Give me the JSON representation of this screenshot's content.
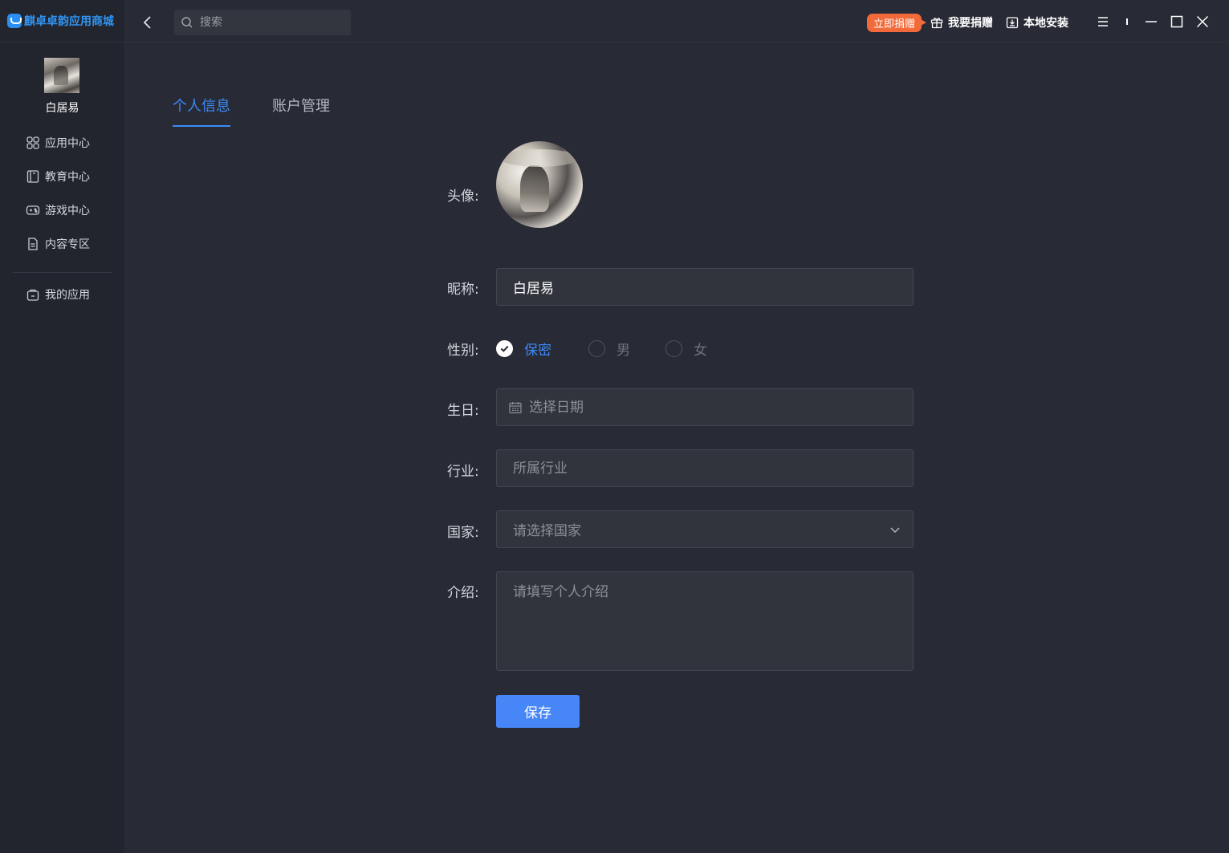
{
  "app": {
    "logo_text": "麒卓卓韵应用商城"
  },
  "sidebar": {
    "user_name": "白居易",
    "items": [
      {
        "label": "应用中心",
        "icon": "apps-grid-icon"
      },
      {
        "label": "教育中心",
        "icon": "book-icon"
      },
      {
        "label": "游戏中心",
        "icon": "gamepad-icon"
      },
      {
        "label": "内容专区",
        "icon": "document-icon"
      }
    ],
    "my_apps": {
      "label": "我的应用",
      "icon": "bag-icon"
    }
  },
  "topbar": {
    "search_placeholder": "搜索",
    "donate_badge": "立即捐赠",
    "donate_label": "我要捐赠",
    "local_install_label": "本地安装"
  },
  "tabs": [
    {
      "label": "个人信息",
      "active": true
    },
    {
      "label": "账户管理",
      "active": false
    }
  ],
  "form": {
    "avatar_label": "头像:",
    "nickname_label": "昵称:",
    "nickname_value": "白居易",
    "gender_label": "性别:",
    "gender_options": [
      {
        "label": "保密",
        "checked": true
      },
      {
        "label": "男",
        "checked": false
      },
      {
        "label": "女",
        "checked": false
      }
    ],
    "birthday_label": "生日:",
    "birthday_placeholder": "选择日期",
    "industry_label": "行业:",
    "industry_placeholder": "所属行业",
    "country_label": "国家:",
    "country_placeholder": "请选择国家",
    "intro_label": "介绍:",
    "intro_placeholder": "请填写个人介绍",
    "save_label": "保存"
  },
  "colors": {
    "accent": "#3d8af7",
    "donate": "#f36a3a",
    "background": "#282a35",
    "sidebar": "#23252e"
  }
}
